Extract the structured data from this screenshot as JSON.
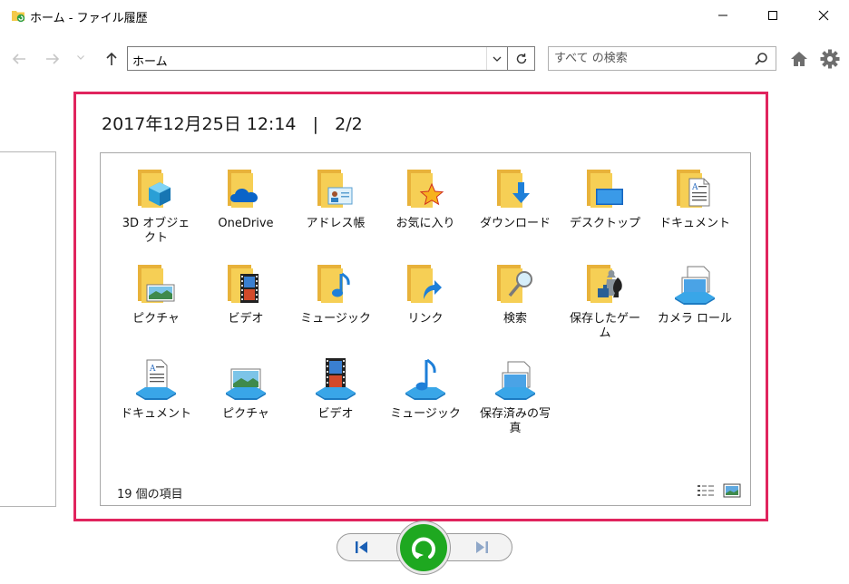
{
  "window": {
    "title": "ホーム - ファイル履歴"
  },
  "toolbar": {
    "address": "ホーム",
    "search_placeholder": "すべて の検索"
  },
  "snapshot": {
    "info": "2017年12月25日 12:14   |   2/2"
  },
  "items": [
    {
      "label": "3D オブジェクト",
      "icon": "3d-objects-folder-icon"
    },
    {
      "label": "OneDrive",
      "icon": "onedrive-folder-icon"
    },
    {
      "label": "アドレス帳",
      "icon": "contacts-folder-icon"
    },
    {
      "label": "お気に入り",
      "icon": "favorites-folder-icon"
    },
    {
      "label": "ダウンロード",
      "icon": "downloads-folder-icon"
    },
    {
      "label": "デスクトップ",
      "icon": "desktop-folder-icon"
    },
    {
      "label": "ドキュメント",
      "icon": "documents-folder-icon"
    },
    {
      "label": "ピクチャ",
      "icon": "pictures-folder-icon"
    },
    {
      "label": "ビデオ",
      "icon": "videos-folder-icon"
    },
    {
      "label": "ミュージック",
      "icon": "music-folder-icon"
    },
    {
      "label": "リンク",
      "icon": "links-folder-icon"
    },
    {
      "label": "検索",
      "icon": "searches-folder-icon"
    },
    {
      "label": "保存したゲーム",
      "icon": "saved-games-folder-icon"
    },
    {
      "label": "カメラ ロール",
      "icon": "camera-roll-library-icon"
    },
    {
      "label": "ドキュメント",
      "icon": "documents-library-icon"
    },
    {
      "label": "ピクチャ",
      "icon": "pictures-library-icon"
    },
    {
      "label": "ビデオ",
      "icon": "videos-library-icon"
    },
    {
      "label": "ミュージック",
      "icon": "music-library-icon"
    },
    {
      "label": "保存済みの写真",
      "icon": "saved-pictures-library-icon"
    }
  ],
  "status": {
    "item_count": "19 個の項目"
  },
  "colors": {
    "highlight_frame": "#e0245e",
    "restore_button": "#1ea820",
    "folder_yellow": "#f4c94a"
  }
}
